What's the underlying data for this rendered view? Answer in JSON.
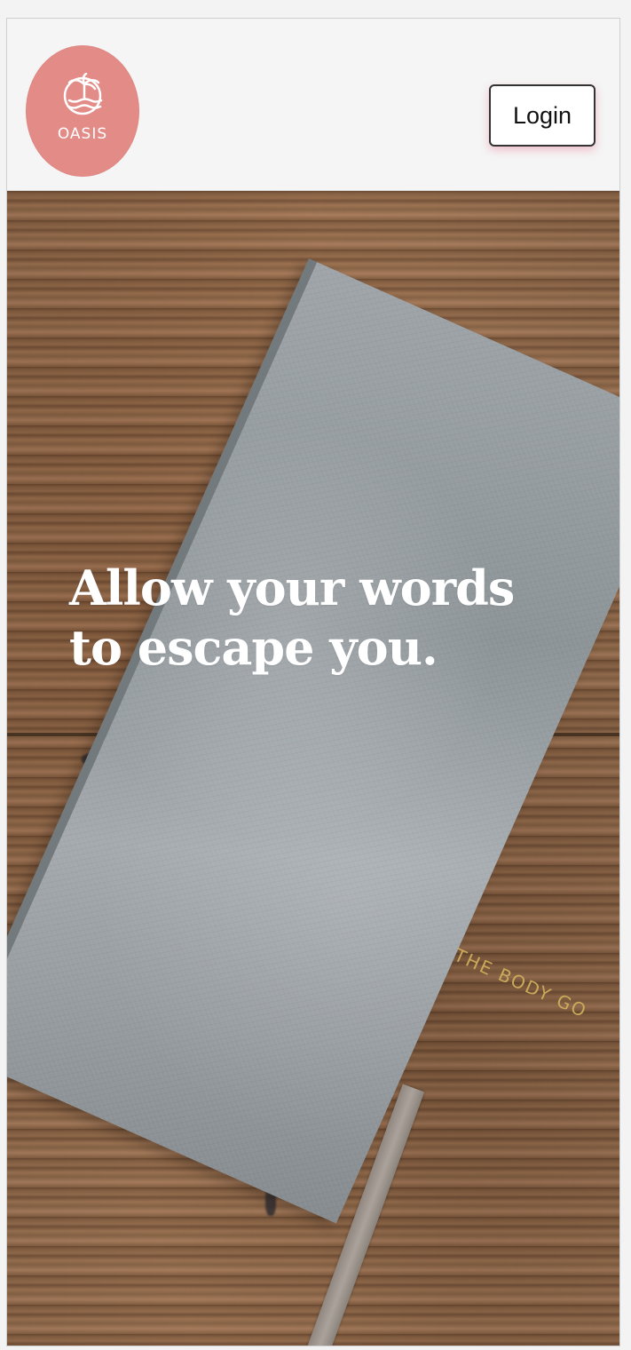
{
  "header": {
    "logo_text": "OASIS",
    "login_label": "Login"
  },
  "hero": {
    "headline_line1": "Allow your words",
    "headline_line2": "to escape you.",
    "notebook_emboss": "THE BODY GO"
  },
  "colors": {
    "logo_background": "#E28B87",
    "header_background": "#F5F5F5",
    "button_shadow": "#E77D96",
    "headline_text": "#FFFFFF",
    "notebook_gray": "#9AA0A4",
    "emboss_gold": "#D1B15D"
  },
  "icons": {
    "logo_icon": "palm-tree-sun-waves-icon"
  }
}
